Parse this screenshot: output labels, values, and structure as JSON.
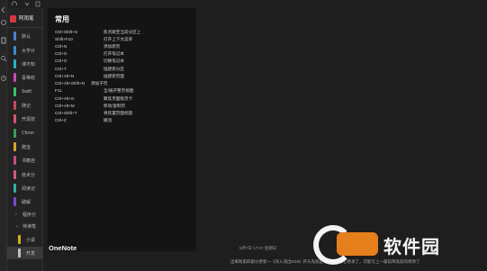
{
  "rail_icons": [
    "back-icon",
    "sync-icon",
    "notebook-icon",
    "search-icon",
    "recent-icon"
  ],
  "notebook": {
    "name": "阿雨笔"
  },
  "sections": [
    {
      "label": "默认",
      "color": "#4b7fd6"
    },
    {
      "label": "大学计",
      "color": "#3f8bd0"
    },
    {
      "label": "课不知",
      "color": "#2bb0c8"
    },
    {
      "label": "喜等收",
      "color": "#c94ab8"
    },
    {
      "label": "Swift",
      "color": "#3dbf6a"
    },
    {
      "label": "随记",
      "color": "#c94a5f"
    },
    {
      "label": "开源技",
      "color": "#d9556e"
    },
    {
      "label": "Chron",
      "color": "#35a05a"
    },
    {
      "label": "爬虫",
      "color": "#d9a030"
    },
    {
      "label": "书籍自",
      "color": "#c94a8a"
    },
    {
      "label": "技术分",
      "color": "#d15a7a"
    },
    {
      "label": "阅读记",
      "color": "#2fb0a8"
    },
    {
      "label": "破解",
      "color": "#7a4ad0"
    }
  ],
  "groups": [
    {
      "label": "程序分"
    },
    {
      "label": "待读笔"
    }
  ],
  "sub_sections": [
    {
      "label": "小说",
      "color": "#d8b020"
    },
    {
      "label": "开发",
      "color": "#c0c0c0"
    }
  ],
  "shortcut_panel": {
    "title": "常用",
    "footer": "OneNote",
    "shortcuts": [
      {
        "key": "Ctrl+Shift+G",
        "desc": "焦点跳至当前分区上"
      },
      {
        "key": "Shift+F10",
        "desc": "打开上下文菜单"
      },
      {
        "key": "Ctrl+N",
        "desc": "添加新页"
      },
      {
        "key": "Ctrl+O",
        "desc": "打开笔记本"
      },
      {
        "key": "Ctrl+G",
        "desc": "切换笔记本"
      },
      {
        "key": "Ctrl+T",
        "desc": "插建新分区"
      },
      {
        "key": "Ctrl+Alt+N",
        "desc": "插建新页面"
      },
      {
        "key": "Ctrl+Alt+Shift+N",
        "desc": "添加子页"
      },
      {
        "key": "F11",
        "desc": "全/展开整页视图"
      },
      {
        "key": "Ctrl+Alt+G",
        "desc": "聚焦页面版页卡"
      },
      {
        "key": "Ctrl+Alt+M",
        "desc": "移动/复制页"
      },
      {
        "key": "Ctrl+Shift+T",
        "desc": "将焦置页面标题"
      },
      {
        "key": "Ctrl+Z",
        "desc": "撤消"
      }
    ]
  },
  "page": {
    "date": "5月7日 17:07 星期日",
    "body": "出来啦第四部分更新一《深入浅出ES6》开头先就是写完ES6和它继承了，可能写上一篇前简笔前的修改了"
  },
  "watermark": {
    "text": "软件园"
  }
}
